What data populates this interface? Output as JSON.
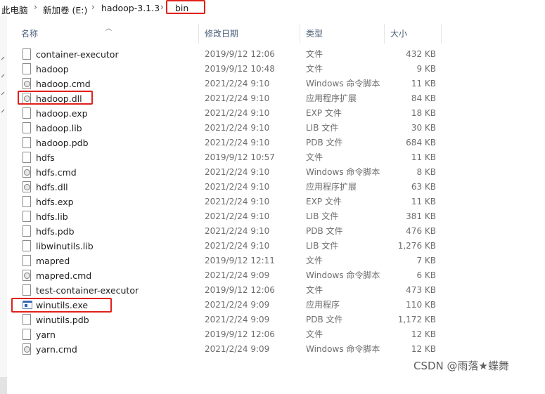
{
  "breadcrumb": {
    "items": [
      "此电脑",
      "新加卷 (E:)",
      "hadoop-3.1.3",
      "bin"
    ],
    "separator": "›"
  },
  "columns": {
    "name": "名称",
    "date": "修改日期",
    "type": "类型",
    "size": "大小"
  },
  "files": [
    {
      "name": "container-executor",
      "date": "2019/9/12 12:06",
      "type": "文件",
      "size": "432 KB",
      "icon": "file-icon"
    },
    {
      "name": "hadoop",
      "date": "2019/9/12 10:48",
      "type": "文件",
      "size": "9 KB",
      "icon": "file-icon"
    },
    {
      "name": "hadoop.cmd",
      "date": "2021/2/24 9:10",
      "type": "Windows 命令脚本",
      "size": "11 KB",
      "icon": "script-icon"
    },
    {
      "name": "hadoop.dll",
      "date": "2021/2/24 9:10",
      "type": "应用程序扩展",
      "size": "84 KB",
      "icon": "dll-icon"
    },
    {
      "name": "hadoop.exp",
      "date": "2021/2/24 9:10",
      "type": "EXP 文件",
      "size": "18 KB",
      "icon": "file-icon"
    },
    {
      "name": "hadoop.lib",
      "date": "2021/2/24 9:10",
      "type": "LIB 文件",
      "size": "30 KB",
      "icon": "file-icon"
    },
    {
      "name": "hadoop.pdb",
      "date": "2021/2/24 9:10",
      "type": "PDB 文件",
      "size": "684 KB",
      "icon": "file-icon"
    },
    {
      "name": "hdfs",
      "date": "2019/9/12 10:57",
      "type": "文件",
      "size": "11 KB",
      "icon": "file-icon"
    },
    {
      "name": "hdfs.cmd",
      "date": "2021/2/24 9:10",
      "type": "Windows 命令脚本",
      "size": "8 KB",
      "icon": "script-icon"
    },
    {
      "name": "hdfs.dll",
      "date": "2021/2/24 9:10",
      "type": "应用程序扩展",
      "size": "63 KB",
      "icon": "dll-icon"
    },
    {
      "name": "hdfs.exp",
      "date": "2021/2/24 9:10",
      "type": "EXP 文件",
      "size": "11 KB",
      "icon": "file-icon"
    },
    {
      "name": "hdfs.lib",
      "date": "2021/2/24 9:10",
      "type": "LIB 文件",
      "size": "381 KB",
      "icon": "file-icon"
    },
    {
      "name": "hdfs.pdb",
      "date": "2021/2/24 9:10",
      "type": "PDB 文件",
      "size": "476 KB",
      "icon": "file-icon"
    },
    {
      "name": "libwinutils.lib",
      "date": "2021/2/24 9:10",
      "type": "LIB 文件",
      "size": "1,276 KB",
      "icon": "file-icon"
    },
    {
      "name": "mapred",
      "date": "2019/9/12 12:11",
      "type": "文件",
      "size": "7 KB",
      "icon": "file-icon"
    },
    {
      "name": "mapred.cmd",
      "date": "2021/2/24 9:09",
      "type": "Windows 命令脚本",
      "size": "6 KB",
      "icon": "script-icon"
    },
    {
      "name": "test-container-executor",
      "date": "2019/9/12 12:06",
      "type": "文件",
      "size": "473 KB",
      "icon": "file-icon"
    },
    {
      "name": "winutils.exe",
      "date": "2021/2/24 9:09",
      "type": "应用程序",
      "size": "110 KB",
      "icon": "exe-icon"
    },
    {
      "name": "winutils.pdb",
      "date": "2021/2/24 9:09",
      "type": "PDB 文件",
      "size": "1,172 KB",
      "icon": "file-icon"
    },
    {
      "name": "yarn",
      "date": "2019/9/12 12:06",
      "type": "文件",
      "size": "12 KB",
      "icon": "file-icon"
    },
    {
      "name": "yarn.cmd",
      "date": "2021/2/24 9:09",
      "type": "Windows 命令脚本",
      "size": "12 KB",
      "icon": "script-icon"
    }
  ],
  "highlighted": [
    "bin",
    "hadoop.dll",
    "winutils.exe"
  ],
  "highlight_color": "#e0201b",
  "watermark": "CSDN @雨落★蝶舞"
}
